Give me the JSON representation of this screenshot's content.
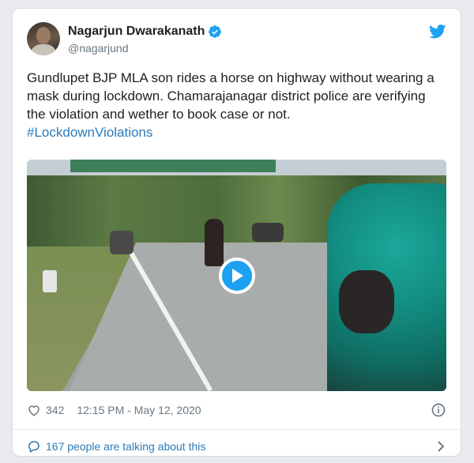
{
  "tweet": {
    "author_name": "Nagarjun Dwarakanath",
    "author_handle": "@nagarjund",
    "text": "Gundlupet BJP MLA son rides a horse on highway without wearing a mask during lockdown. Chamarajanagar district police are verifying the violation and wether to book case or not.",
    "hashtag": "#LockdownViolations",
    "likes": "342",
    "timestamp": "12:15 PM - May 12, 2020",
    "conversation": "167 people are talking about this"
  },
  "icons": {
    "verified": "verified-badge-icon",
    "brand": "twitter-bird-icon",
    "play": "play-icon",
    "like": "heart-icon",
    "info": "info-icon",
    "reply": "speech-bubble-icon",
    "chevron": "chevron-right-icon"
  },
  "colors": {
    "accent": "#1da1f2",
    "link": "#2b7bb9",
    "text": "#1c2022",
    "muted": "#697882"
  }
}
